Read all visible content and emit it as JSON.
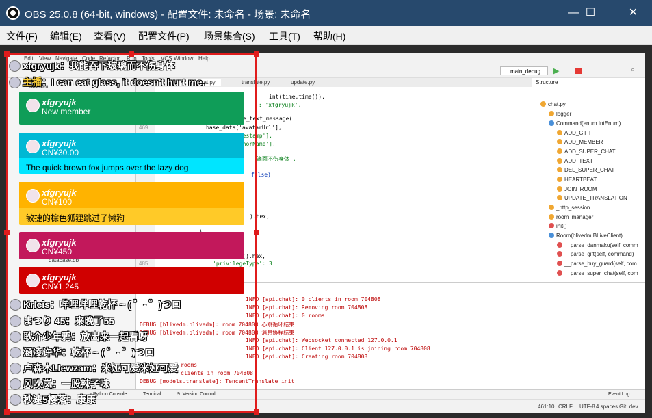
{
  "window": {
    "title": "OBS 25.0.8 (64-bit, windows) - 配置文件: 未命名 - 场景: 未命名",
    "minimize": "—",
    "maximize": "☐",
    "close": "✕"
  },
  "menu": [
    "文件(F)",
    "编辑(E)",
    "查看(V)",
    "配置文件(P)",
    "场景集合(S)",
    "工具(T)",
    "帮助(H)"
  ],
  "ide": {
    "menu": [
      "Edit",
      "View",
      "Navigate",
      "Code",
      "Refactor",
      "Run",
      "Tools",
      "VCS",
      "Window",
      "Help"
    ],
    "run_config": "main_debug",
    "tabs": [
      "chat.py",
      "translate.py",
      "update.py"
    ],
    "project": [
      "blivedm",
      "api",
      "blivedm",
      "database.db",
      "log"
    ],
    "gutter": [
      "469",
      "485"
    ],
    "code": [
      "int(time.time()),",
      "': 'xfgryujk',",
      "e_text_message(",
      "base_data['avatarUrl'],",
      "imestamp'],",
      "uthorName'],",
      "滴面不伤身体',",
      "false)",
      ").hex,",
      ")",
      "uid4().hex,",
      "'privilegeType': 3"
    ],
    "structure_title": "Structure",
    "structure": [
      "chat.py",
      "logger",
      "Command(enum.IntEnum)",
      "ADD_GIFT",
      "ADD_MEMBER",
      "ADD_SUPER_CHAT",
      "ADD_TEXT",
      "DEL_SUPER_CHAT",
      "HEARTBEAT",
      "JOIN_ROOM",
      "UPDATE_TRANSLATION",
      "_http_session",
      "room_manager",
      "init()",
      "Room(blivedm.BLiveClient)",
      "__parse_danmaku(self, comm",
      "__parse_gift(self, command)",
      "__parse_buy_guard(self, com",
      "__parse_super_chat(self, com"
    ],
    "log": [
      "INFO [api.chat]: 0 clients in room 704808",
      "INFO [api.chat]: Removing room 704808",
      "INFO [api.chat]: 0 rooms",
      "DEBUG [blivedm.blivedm]: room 704808 心跳循环结束",
      "DEBUG [blivedm.blivedm]: room 704808 消息协程结束",
      "INFO [api.chat]: Websocket connected 127.0.0.1",
      "INFO [api.chat]: Client 127.0.0.1 is joining room 704808",
      "INFO [api.chat]: Creating room 704808",
      "rooms",
      "clients in room 704808",
      "DEBUG [models.translate]: TencentTranslate init"
    ],
    "bottom_tools": [
      "Python Console",
      "Terminal",
      "9: Version Control",
      "Event Log"
    ],
    "status": [
      "461:10",
      "CRLF",
      "UTF-8",
      "4 spaces",
      "Git: dev"
    ]
  },
  "overlay": {
    "top_messages": [
      {
        "name": "xfgryujk",
        "text": "我能吞下玻璃而不伤身体"
      },
      {
        "name": "主播",
        "text": "I can eat glass, it doesn't hurt me."
      }
    ],
    "cards": [
      {
        "name": "xfgryujk",
        "sub": "New member",
        "msg": "",
        "color": "#0f9d58"
      },
      {
        "name": "xfgryujk",
        "sub": "CN¥30.00",
        "msg": "The quick brown fox jumps over the lazy dog",
        "color": "#00b8d4"
      },
      {
        "name": "xfgryujk",
        "sub": "CN¥100",
        "msg": "敏捷的棕色狐狸跳过了懒狗",
        "color": "#ffb300"
      },
      {
        "name": "xfgryujk",
        "sub": "CN¥450",
        "msg": "",
        "color": "#c2185b"
      },
      {
        "name": "xfgryujk",
        "sub": "CN¥1,245",
        "msg": "",
        "color": "#d00000"
      }
    ],
    "bottom_messages": [
      {
        "name": "Krleis",
        "text": "哔哩哔哩乾杯 ~ ( ゜- ゜)つロ"
      },
      {
        "name": "まつり 45",
        "text": "来晚了55"
      },
      {
        "name": "耿介少年鸦",
        "text": "放出来一起看呀"
      },
      {
        "name": "涵凌许华",
        "text": "乾杯 ~ ( ゜- ゜)つロ"
      },
      {
        "name": "卢森木Llewzam",
        "text": "米娅可爱米娅可爱"
      },
      {
        "name": "风吹岚",
        "text": "一股辣子味"
      },
      {
        "name": "秒速5樱落",
        "text": "康康"
      }
    ]
  }
}
